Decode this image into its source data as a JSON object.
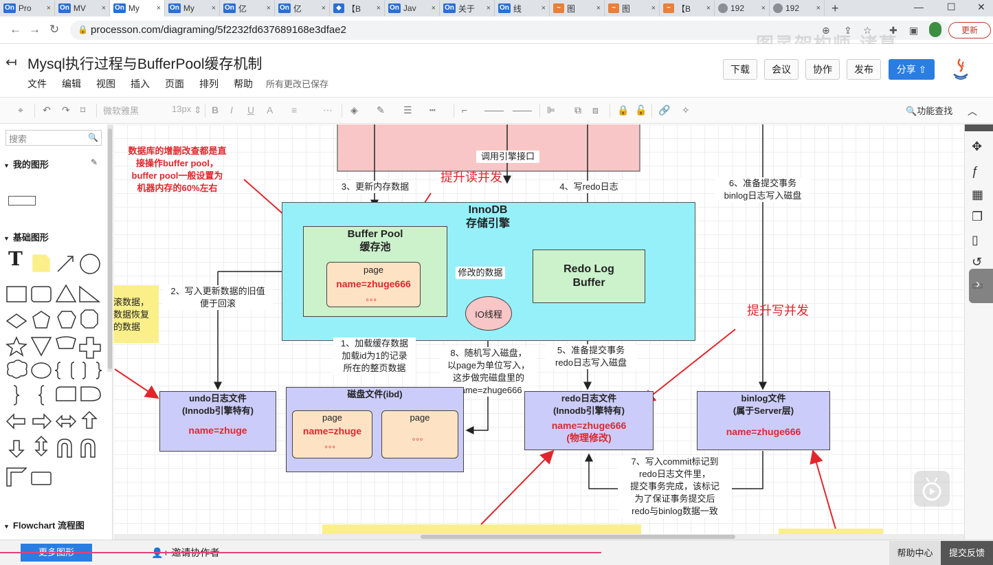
{
  "browser": {
    "tabs": [
      {
        "fav": "On",
        "title": "Pro",
        "active": false
      },
      {
        "fav": "On",
        "title": "MV",
        "active": false
      },
      {
        "fav": "On",
        "title": "My",
        "active": true
      },
      {
        "fav": "On",
        "title": "My",
        "active": false
      },
      {
        "fav": "On",
        "title": "亿",
        "active": false
      },
      {
        "fav": "On",
        "title": "亿",
        "active": false
      },
      {
        "fav": "◆",
        "title": "【B",
        "active": false
      },
      {
        "fav": "On",
        "title": "Jav",
        "active": false
      },
      {
        "fav": "On",
        "title": "关于",
        "active": false
      },
      {
        "fav": "On",
        "title": "线",
        "active": false
      },
      {
        "fav": "~",
        "title": "图",
        "active": false
      },
      {
        "fav": "~",
        "title": "图",
        "active": false
      },
      {
        "fav": "~",
        "title": "【B",
        "active": false
      },
      {
        "fav": "",
        "title": "192",
        "active": false
      },
      {
        "fav": "",
        "title": "192",
        "active": false
      }
    ],
    "new_tab": "+",
    "url": "processon.com/diagraming/5f2232fd637689168e3dfae2",
    "update_button": "更新",
    "watermark": "图灵架构师-诸葛"
  },
  "app": {
    "doc_title": "Mysql执行过程与BufferPool缓存机制",
    "menus": [
      "文件",
      "编辑",
      "视图",
      "插入",
      "页面",
      "排列",
      "帮助"
    ],
    "save_status": "所有更改已保存",
    "buttons": {
      "download": "下载",
      "meeting": "会议",
      "collab": "协作",
      "publish": "发布",
      "share": "分享"
    }
  },
  "toolbar": {
    "font_name": "微软雅黑",
    "font_size": "13px",
    "find": "功能查找"
  },
  "sidebar": {
    "search_placeholder": "搜索",
    "my_shapes": "我的图形",
    "basic_shapes": "基础图形",
    "flowchart": "Flowchart 流程图"
  },
  "status": {
    "more_shapes": "更多图形",
    "invite": "邀请协作者",
    "help": "帮助中心",
    "feedback": "提交反馈"
  },
  "diagram": {
    "note_left": [
      "数据库的增删改查都是直",
      "接操作buffer pool，",
      "buffer pool一般设置为",
      "机器内存的60%左右"
    ],
    "note_cut": [
      "滚数据，",
      "数据恢复",
      "的数据"
    ],
    "call_engine": "调用引擎接口",
    "step3": "3、更新内存数据",
    "step4": "4、写redo日志",
    "step6": [
      "6、准备提交事务",
      "binlog日志写入磁盘"
    ],
    "improve_read": "提升读并发",
    "improve_write": "提升写并发",
    "innodb_title": [
      "InnoDB",
      "存储引擎"
    ],
    "buffer_pool": [
      "Buffer Pool",
      "缓存池"
    ],
    "bp_page": {
      "title": "page",
      "name": "name=zhuge666",
      "dots": "。。。"
    },
    "modified_data": "修改的数据",
    "io_thread": "IO线程",
    "redo_buffer": [
      "Redo Log",
      "Buffer"
    ],
    "step2": [
      "2、写入更新数据的旧值",
      "便于回滚"
    ],
    "step1": [
      "1、加载缓存数据",
      "加载id为1的记录",
      "所在的整页数据"
    ],
    "step8": [
      "8、随机写入磁盘，",
      "以page为单位写入，",
      "这步做完磁盘里的",
      "name=zhuge666"
    ],
    "step5": [
      "5、准备提交事务",
      "redo日志写入磁盘"
    ],
    "undo_file": {
      "title": [
        "undo日志文件",
        "(Innodb引擎特有)"
      ],
      "name": "name=zhuge"
    },
    "disk_file": {
      "title": "磁盘文件(ibd)",
      "page1": {
        "title": "page",
        "name": "name=zhuge",
        "dots": "。。。"
      },
      "page2": {
        "title": "page",
        "dots": "。。。"
      }
    },
    "redo_file": {
      "title": [
        "redo日志文件",
        "(Innodb引擎特有)"
      ],
      "name": [
        "name=zhuge666",
        "(物理修改)"
      ]
    },
    "binlog_file": {
      "title": [
        "binlog文件",
        "(属于Server层)"
      ],
      "name": "name=zhuge666"
    },
    "step7": [
      "7、写入commit标记到",
      "redo日志文件里，",
      "提交事务完成，该标记",
      "为了保证事务提交后",
      "redo与binlog数据一致"
    ]
  }
}
